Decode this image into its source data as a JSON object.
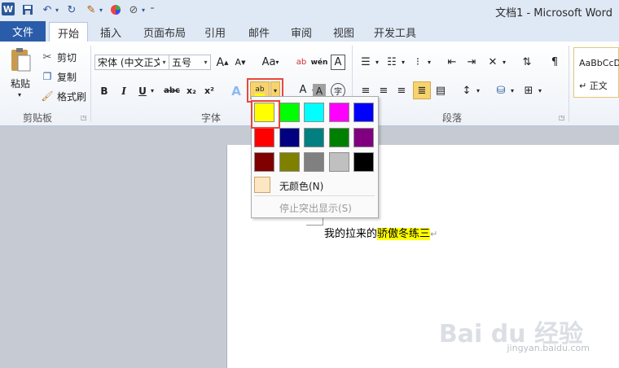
{
  "window": {
    "title": "文档1 - Microsoft Word",
    "app_logo": "W"
  },
  "qat": {
    "icons": [
      "save-icon",
      "undo-icon",
      "redo-icon",
      "format-painter-icon",
      "color-wheel-icon",
      "draw-icon",
      "customize-icon"
    ]
  },
  "tabs": [
    {
      "label": "文件"
    },
    {
      "label": "开始"
    },
    {
      "label": "插入"
    },
    {
      "label": "页面布局"
    },
    {
      "label": "引用"
    },
    {
      "label": "邮件"
    },
    {
      "label": "审阅"
    },
    {
      "label": "视图"
    },
    {
      "label": "开发工具"
    }
  ],
  "clipboard": {
    "paste": "粘贴",
    "cut": "剪切",
    "copy": "复制",
    "format_painter": "格式刷",
    "group_label": "剪贴板"
  },
  "font": {
    "font_name": "宋体 (中文正文",
    "font_size": "五号",
    "grow": "A",
    "shrink": "A",
    "change_case": "Aa",
    "clear_format": "ab",
    "phonetic": "wén",
    "border_char": "A",
    "bold": "B",
    "italic": "I",
    "underline": "U",
    "strike": "abc",
    "subscript": "x₂",
    "superscript": "x²",
    "text_effect": "A",
    "highlight": "ab",
    "font_color": "A",
    "shading": "A",
    "enclose": "字",
    "group_label": "字体"
  },
  "paragraph": {
    "group_label": "段落"
  },
  "styles": {
    "sample": "AaBbCcDc",
    "normal": "↵ 正文"
  },
  "highlight_menu": {
    "colors": [
      [
        "#ffff00",
        "#00ff00",
        "#00ffff",
        "#ff00ff",
        "#0000ff"
      ],
      [
        "#ff0000",
        "#000080",
        "#008080",
        "#008000",
        "#800080"
      ],
      [
        "#800000",
        "#808000",
        "#808080",
        "#c0c0c0",
        "#000000"
      ]
    ],
    "no_color": "无颜色(N)",
    "stop_highlight": "停止突出显示(S)"
  },
  "document": {
    "text_before": "我的拉来的",
    "text_highlight": "骄傲冬练三",
    "para_mark": "↵"
  },
  "watermark": {
    "brand": "Bai du 经验",
    "url": "jingyan.baidu.com"
  }
}
